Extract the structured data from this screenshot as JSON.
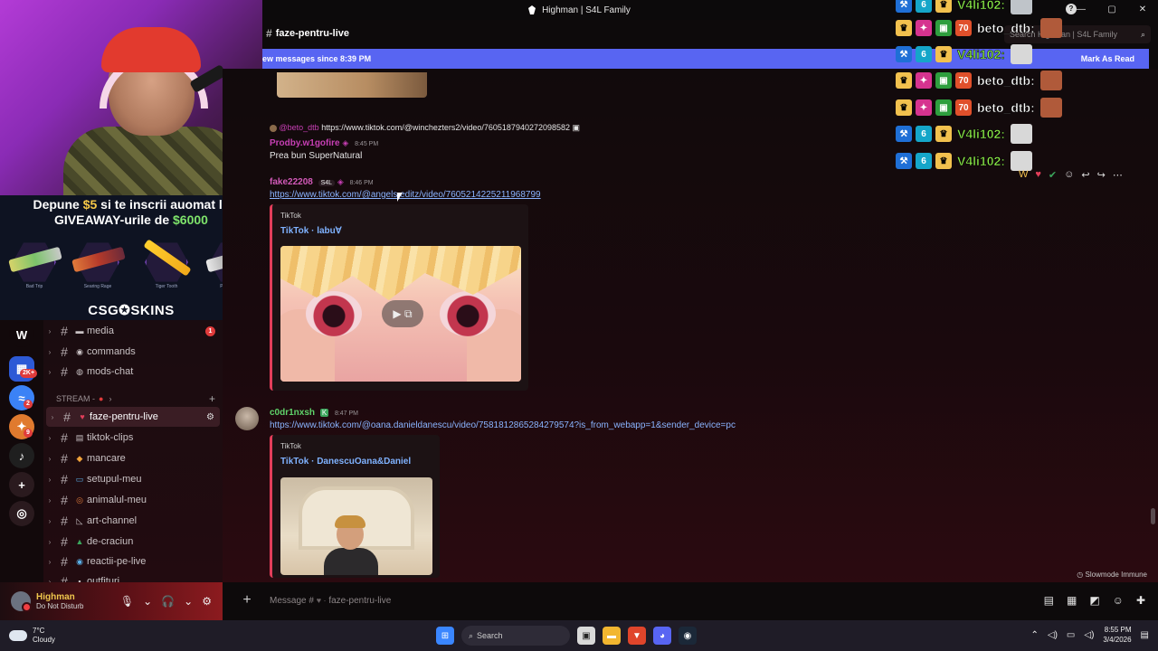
{
  "window": {
    "title": "Highman | S4L Family",
    "controls": [
      "—",
      "▢",
      "✕"
    ]
  },
  "stream_ad": {
    "line1_pre": "Depune ",
    "line1_amount": "$5",
    "line1_post": " si te inscrii auomat la",
    "line2_pre": "GIVEAWAY-urile de ",
    "line2_amount": "$6000",
    "skins": [
      "Bad Trip",
      "Searing Rage",
      "Tiger Tooth",
      "Printstream"
    ],
    "brand": "CSG✪SKINS"
  },
  "server_rail": {
    "badges": [
      "2K+",
      "2",
      "9"
    ]
  },
  "channels": [
    {
      "name": "media",
      "emoji": "▬",
      "badge": "1"
    },
    {
      "name": "commands",
      "emoji": "◉"
    },
    {
      "name": "mods-chat",
      "emoji": "◍"
    }
  ],
  "category": {
    "label": "STREAM -"
  },
  "stream_channels": [
    {
      "name": "faze-pentru-live",
      "emoji": "♥",
      "active": true
    },
    {
      "name": "tiktok-clips",
      "emoji": "▤"
    },
    {
      "name": "mancare",
      "emoji": "◆"
    },
    {
      "name": "setupul-meu",
      "emoji": "▭"
    },
    {
      "name": "animalul-meu",
      "emoji": "◎"
    },
    {
      "name": "art-channel",
      "emoji": "◺"
    },
    {
      "name": "de-craciun",
      "emoji": "▲"
    },
    {
      "name": "reactii-pe-live",
      "emoji": "◉"
    },
    {
      "name": "outfituri",
      "emoji": "▪"
    }
  ],
  "user": {
    "name": "Highman",
    "status": "Do Not Disturb"
  },
  "header": {
    "channel": "faze-pentru-live",
    "search_placeholder": "Search Highman | S4L Family"
  },
  "new_messages_bar": {
    "text": "ew messages since 8:39 PM",
    "action": "Mark As Read"
  },
  "messages": {
    "reply_user": "@beto_dtb",
    "reply_link": "https://www.tiktok.com/@winchezters2/video/7605187940272098582",
    "m1_user": "Prodby.w1gofire",
    "m1_time": "8:45 PM",
    "m1_text": "Prea bun SuperNatural",
    "m2_user": "fake22208",
    "m2_tag": "S4L",
    "m2_time": "8:46 PM",
    "m2_link": "https://www.tiktok.com/@angels.editz/video/7605214225211968799",
    "m2_embed_provider": "TikTok",
    "m2_embed_title": "TikTok · labu∀",
    "m3_user": "c0dr1nxsh",
    "m3_time": "8:47 PM",
    "m3_link": "https://www.tiktok.com/@oana.danieldanescu/video/7581812865284279574?is_from_webapp=1&sender_device=pc",
    "m3_embed_provider": "TikTok",
    "m3_embed_title": "TikTok · DanescuOana&Daniel"
  },
  "overlay_chat": [
    {
      "name": "V4li102:",
      "color": "#8ef04a"
    },
    {
      "name": "beto_dtb:",
      "color": "#ffffff"
    },
    {
      "name": "V4li102:",
      "color": "#8ef04a"
    },
    {
      "name": "beto_dtb:",
      "color": "#ffffff"
    },
    {
      "name": "beto_dtb:",
      "color": "#ffffff"
    },
    {
      "name": "V4li102:",
      "color": "#8ef04a"
    },
    {
      "name": "V4li102:",
      "color": "#8ef04a"
    }
  ],
  "composer": {
    "placeholder_prefix": "Message #",
    "placeholder_channel": "faze-pentru-live",
    "slowmode": "Slowmode Immune"
  },
  "taskbar": {
    "temp": "7°C",
    "condition": "Cloudy",
    "search": "Search",
    "time": "8:55 PM",
    "date": "3/4/2026"
  },
  "colors": {
    "accent": "#5865f2",
    "embed_border": "#e23e5a",
    "link": "#8ab4ff"
  }
}
